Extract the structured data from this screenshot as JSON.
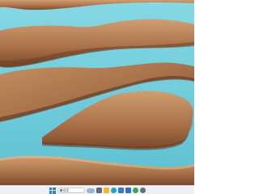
{
  "wallpaper": {
    "subject": "desert-dunes-and-turquoise-lagoons",
    "colors": {
      "sand": "#b07a50",
      "sand_light": "#d0a072",
      "sand_shadow": "#6a3f26",
      "water": "#7fd3e0",
      "water_deep": "#59bdd0"
    }
  },
  "taskbar": {
    "background": "#eef1f4",
    "search": {
      "placeholder": "搜索"
    },
    "pinned": [
      {
        "name": "task-view-icon",
        "color": "#5f6b7a"
      },
      {
        "name": "file-explorer-icon",
        "color": "#f2b632"
      },
      {
        "name": "edge-icon",
        "color": "#1fa2c8"
      },
      {
        "name": "store-icon",
        "color": "#3a77d8"
      },
      {
        "name": "mail-icon",
        "color": "#2f6fd0"
      },
      {
        "name": "chrome-icon",
        "color": "#3aa757"
      },
      {
        "name": "settings-icon",
        "color": "#6b6f78"
      }
    ]
  }
}
